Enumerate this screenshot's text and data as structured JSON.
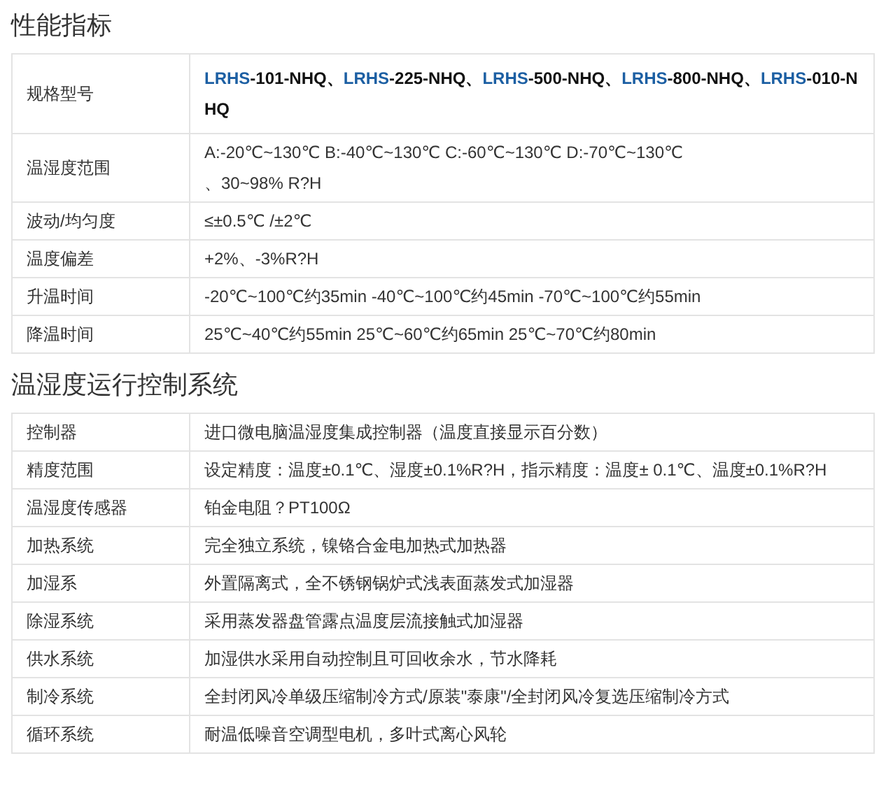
{
  "sections": [
    {
      "title": "性能指标",
      "rows": [
        {
          "label": "规格型号",
          "kind": "models",
          "models": [
            {
              "prefix": "LRHS",
              "suffix": "-101-NHQ、"
            },
            {
              "prefix": "LRHS",
              "suffix": "-225-NHQ、"
            },
            {
              "prefix": "LRHS",
              "suffix": "-500-NHQ、"
            },
            {
              "prefix": "LRHS",
              "suffix": "-800-NHQ、"
            },
            {
              "prefix": "LRHS",
              "suffix": "-010-NHQ"
            }
          ]
        },
        {
          "label": "温湿度范围",
          "kind": "lines",
          "lines": [
            "A:-20℃~130℃ B:-40℃~130℃ C:-60℃~130℃ D:-70℃~130℃",
            "、30~98% R?H"
          ]
        },
        {
          "label": "波动/均匀度",
          "kind": "text",
          "value": "≤±0.5℃ /±2℃"
        },
        {
          "label": "温度偏差",
          "kind": "text",
          "value": "+2%、-3%R?H"
        },
        {
          "label": "升温时间",
          "kind": "text",
          "value": "-20℃~100℃约35min -40℃~100℃约45min -70℃~100℃约55min"
        },
        {
          "label": "降温时间",
          "kind": "text",
          "value": "25℃~40℃约55min 25℃~60℃约65min 25℃~70℃约80min"
        }
      ]
    },
    {
      "title": "温湿度运行控制系统",
      "rows": [
        {
          "label": "控制器",
          "kind": "text",
          "value": "进口微电脑温湿度集成控制器（温度直接显示百分数）"
        },
        {
          "label": "精度范围",
          "kind": "text",
          "value": "设定精度：温度±0.1℃、湿度±0.1%R?H，指示精度：温度± 0.1℃、温度±0.1%R?H"
        },
        {
          "label": "温湿度传感器",
          "kind": "text",
          "value": "铂金电阻？PT100Ω"
        },
        {
          "label": "加热系统",
          "kind": "text",
          "value": "完全独立系统，镍铬合金电加热式加热器"
        },
        {
          "label": "加湿系",
          "kind": "text",
          "value": "外置隔离式，全不锈钢锅炉式浅表面蒸发式加湿器"
        },
        {
          "label": "除湿系统",
          "kind": "text",
          "value": "采用蒸发器盘管露点温度层流接触式加湿器"
        },
        {
          "label": "供水系统",
          "kind": "text",
          "value": "加湿供水采用自动控制且可回收余水，节水降耗"
        },
        {
          "label": "制冷系统",
          "kind": "text",
          "value": "全封闭风冷单级压缩制冷方式/原装\"泰康\"/全封闭风冷复选压缩制冷方式"
        },
        {
          "label": "循环系统",
          "kind": "text",
          "value": "耐温低噪音空调型电机，多叶式离心风轮"
        }
      ]
    }
  ]
}
